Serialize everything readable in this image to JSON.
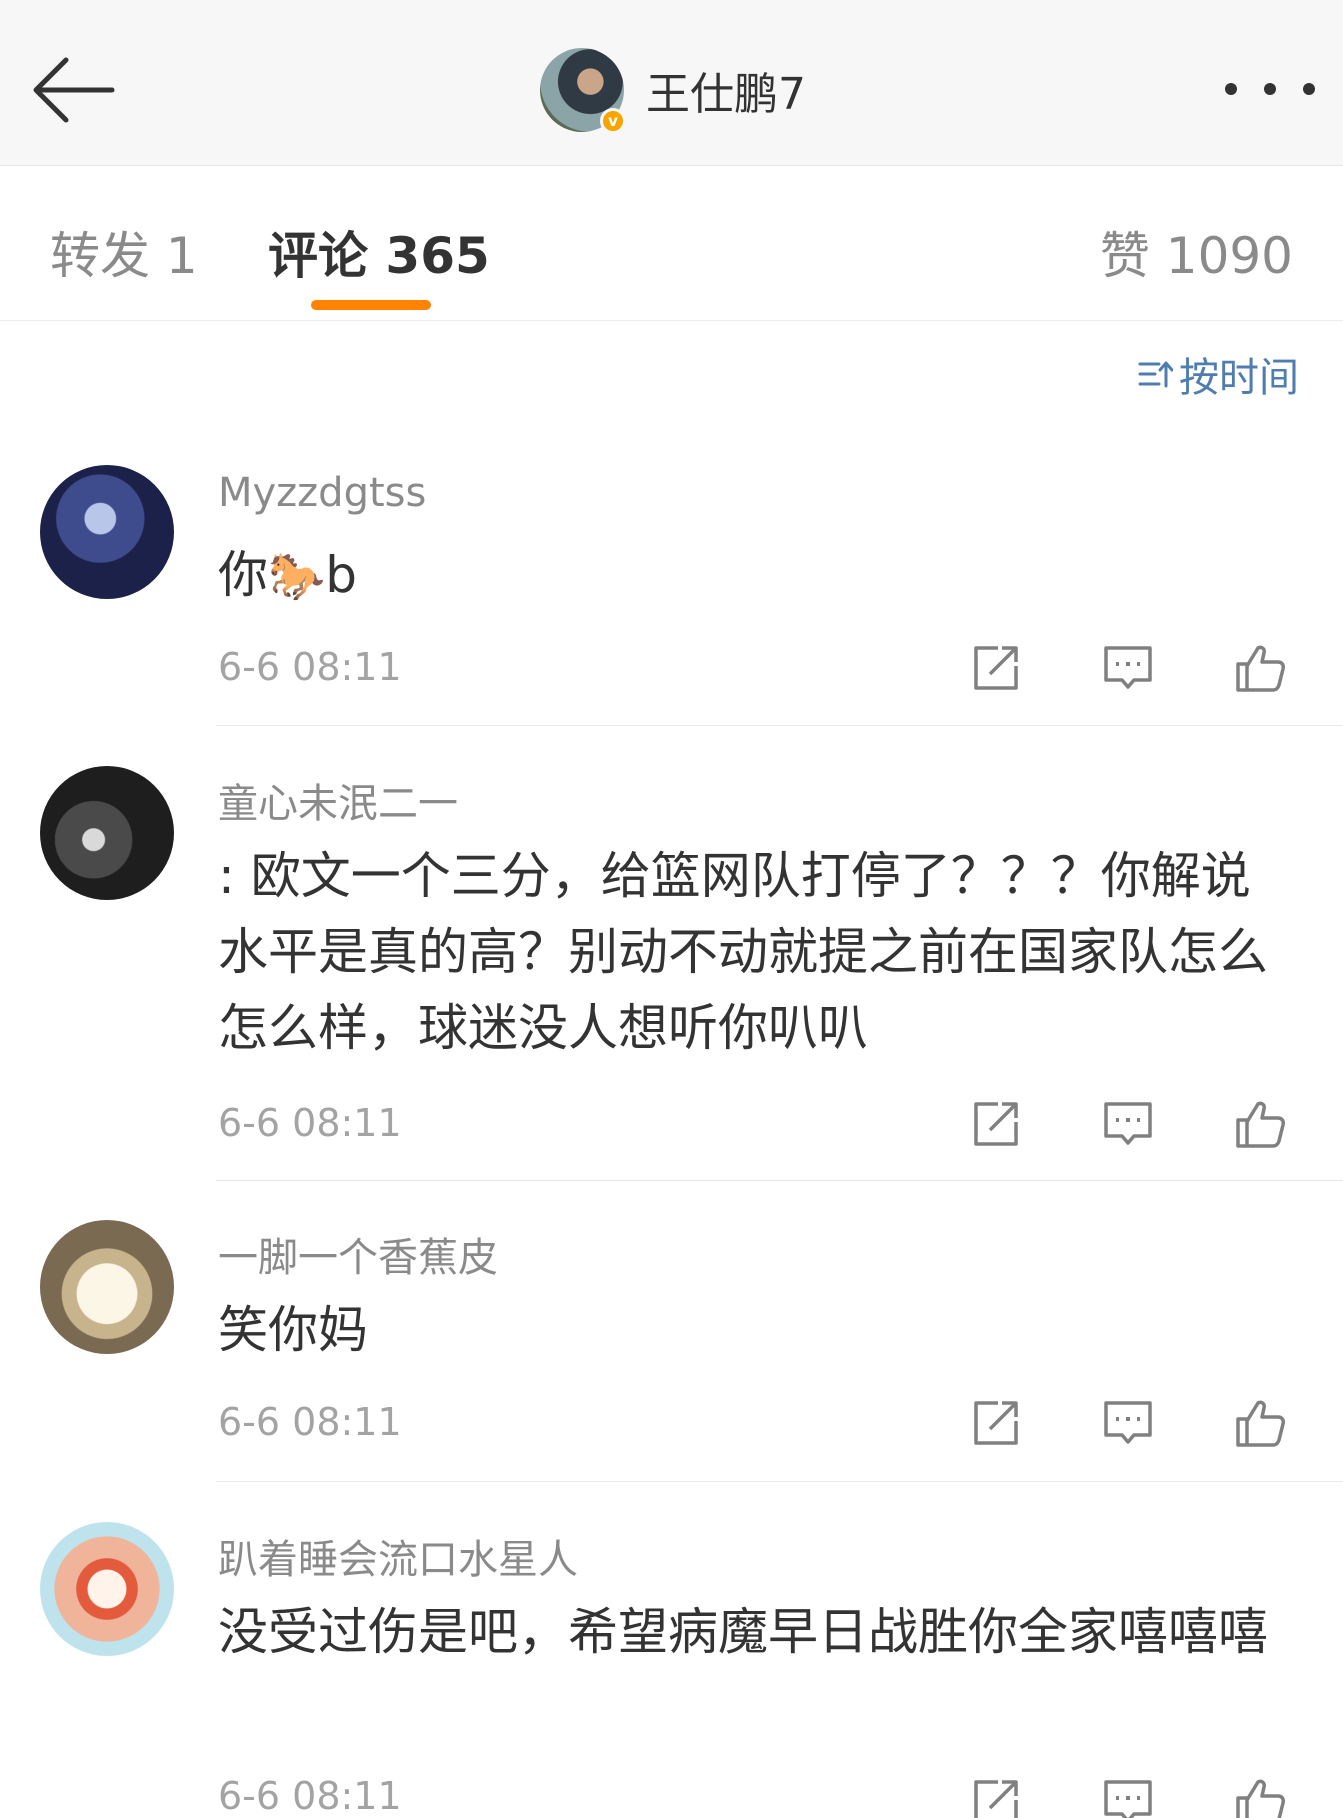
{
  "header": {
    "user_name": "王仕鹏7",
    "verified_badge": "v"
  },
  "tabs": {
    "repost": "转发 1",
    "comments": "评论 365",
    "likes": "赞 1090"
  },
  "sort": {
    "label": "按时间"
  },
  "comments": [
    {
      "nickname": "Myzzdgtss",
      "text_before": "你",
      "emoji": "🐎",
      "text_after": "b",
      "time": "6-6 08:11"
    },
    {
      "nickname": "童心未泯二一",
      "text": ": 欧文一个三分，给篮网队打停了？？？你解说水平是真的高？别动不动就提之前在国家队怎么怎么样，球迷没人想听你叭叭",
      "time": "6-6 08:11"
    },
    {
      "nickname": "一脚一个香蕉皮",
      "text": "笑你妈",
      "time": "6-6 08:11"
    },
    {
      "nickname": "趴着睡会流口水星人",
      "text": "没受过伤是吧，希望病魔早日战胜你全家嘻嘻嘻",
      "time": "6-6 08:11"
    }
  ],
  "colors": {
    "accent": "#ff8200",
    "link": "#507daf",
    "badge": "#f7a500"
  }
}
